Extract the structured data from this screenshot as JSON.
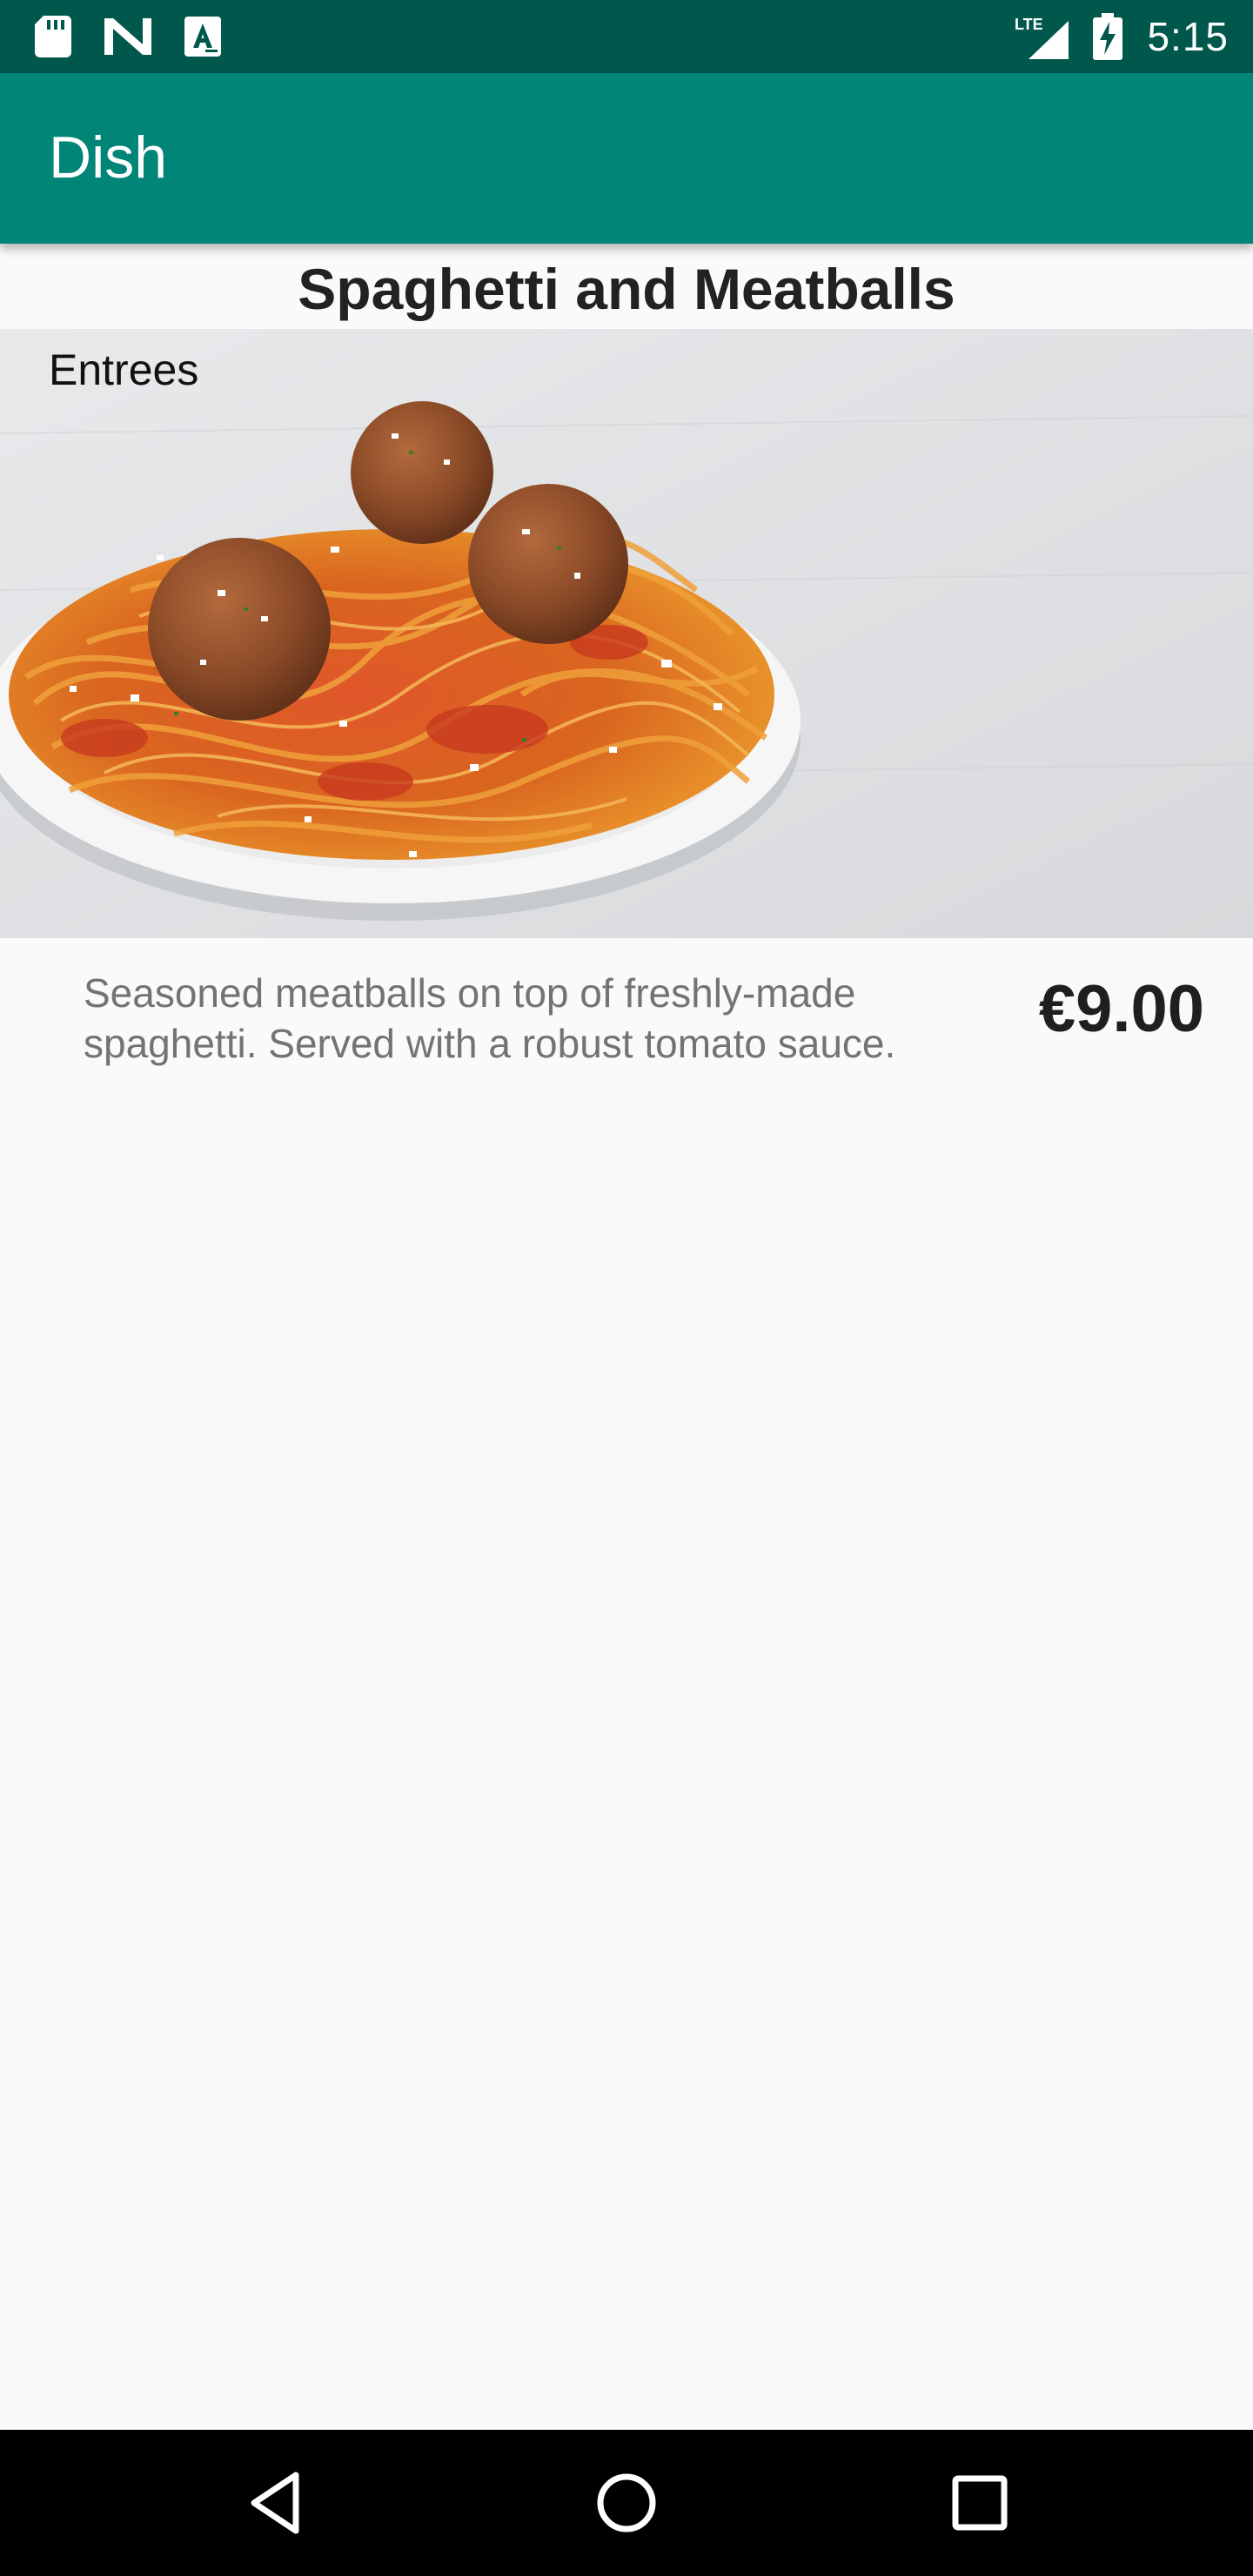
{
  "status_bar": {
    "time": "5:15",
    "network": "LTE",
    "left_icons": [
      "sd-card-icon",
      "n-notification-icon",
      "a-accessibility-icon"
    ],
    "right_icons": [
      "lte-signal-icon",
      "battery-charging-icon"
    ]
  },
  "app_bar": {
    "title": "Dish",
    "color": "#008577",
    "status_color": "#00574b"
  },
  "dish": {
    "name": "Spaghetti and Meatballs",
    "category": "Entrees",
    "description": "Seasoned meatballs on top of freshly-made spaghetti. Served with a robust tomato sauce.",
    "price": "€9.00",
    "image": "spaghetti-and-meatballs-photo"
  },
  "nav_bar": {
    "buttons": [
      "back-icon",
      "home-icon",
      "recents-icon"
    ]
  }
}
